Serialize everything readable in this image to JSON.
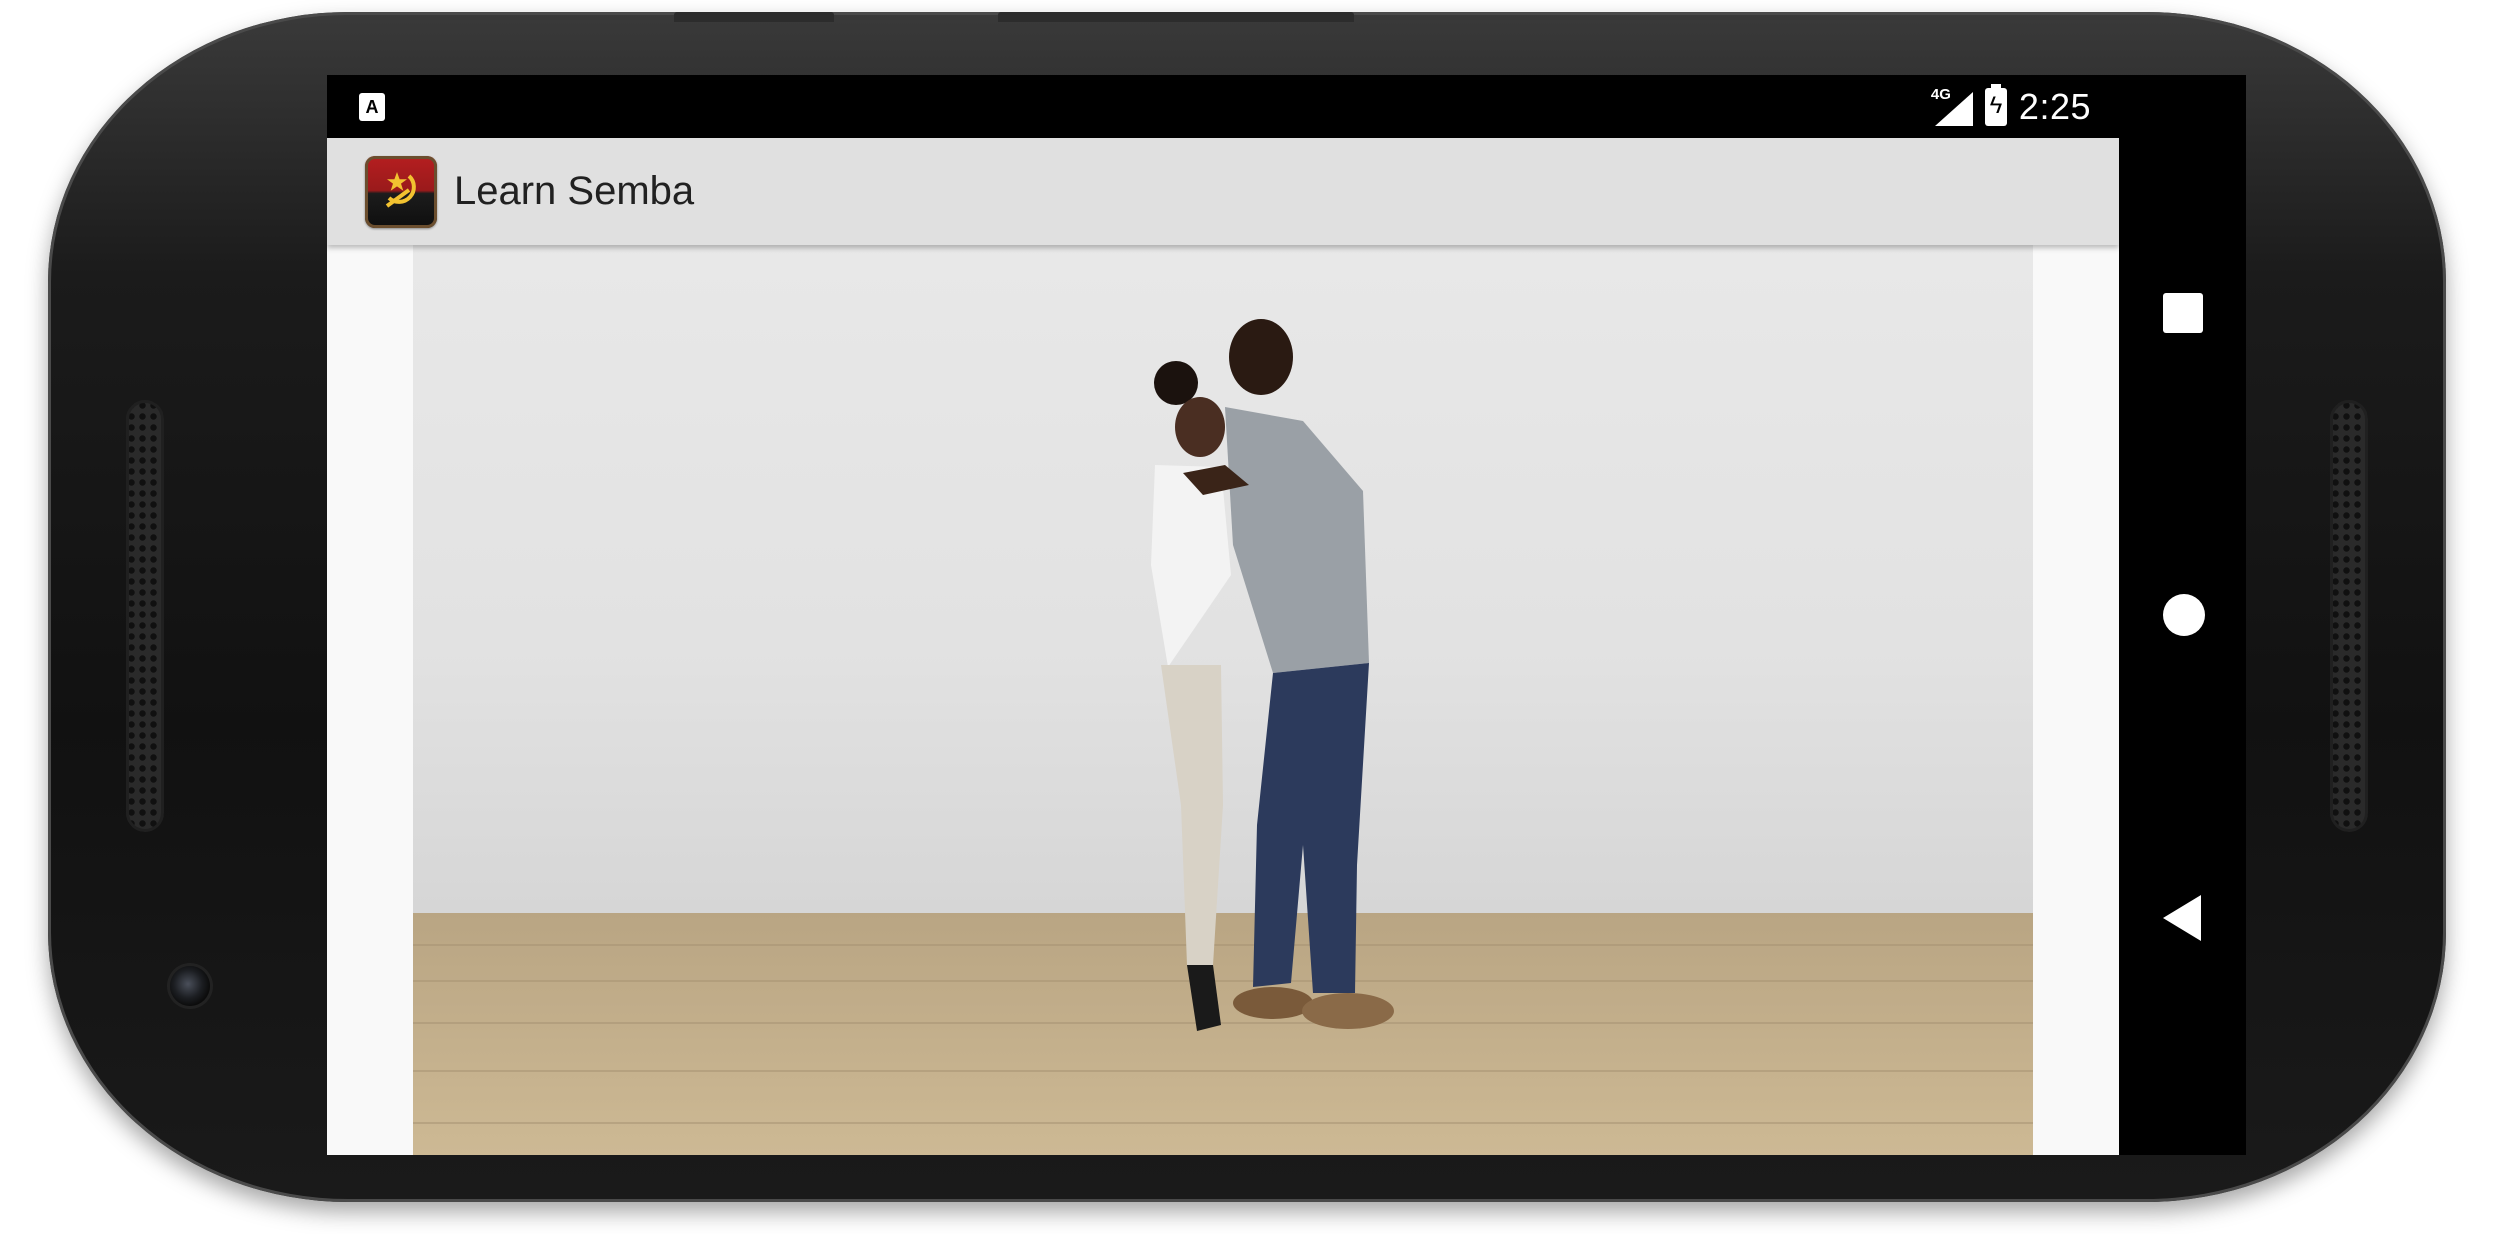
{
  "status_bar": {
    "notification_icon": "a-letter-notification-icon",
    "notification_glyph": "A",
    "network_label": "4G",
    "battery_icon": "battery-charging-icon",
    "time": "2:25"
  },
  "app_bar": {
    "icon": "angola-flag-app-icon",
    "title": "Learn Semba"
  },
  "content": {
    "media": "video-frame: couple dancing semba in a white studio on a wooden floor"
  },
  "nav_bar": {
    "recents_icon": "square-recents-icon",
    "home_icon": "circle-home-icon",
    "back_icon": "triangle-back-icon"
  },
  "colors": {
    "app_bar_bg": "#e0e0e0",
    "status_bar_bg": "#000000",
    "title_text": "#212121",
    "icon_red": "#b51e20",
    "icon_black": "#0e0e0e",
    "emblem_yellow": "#f2c230"
  }
}
